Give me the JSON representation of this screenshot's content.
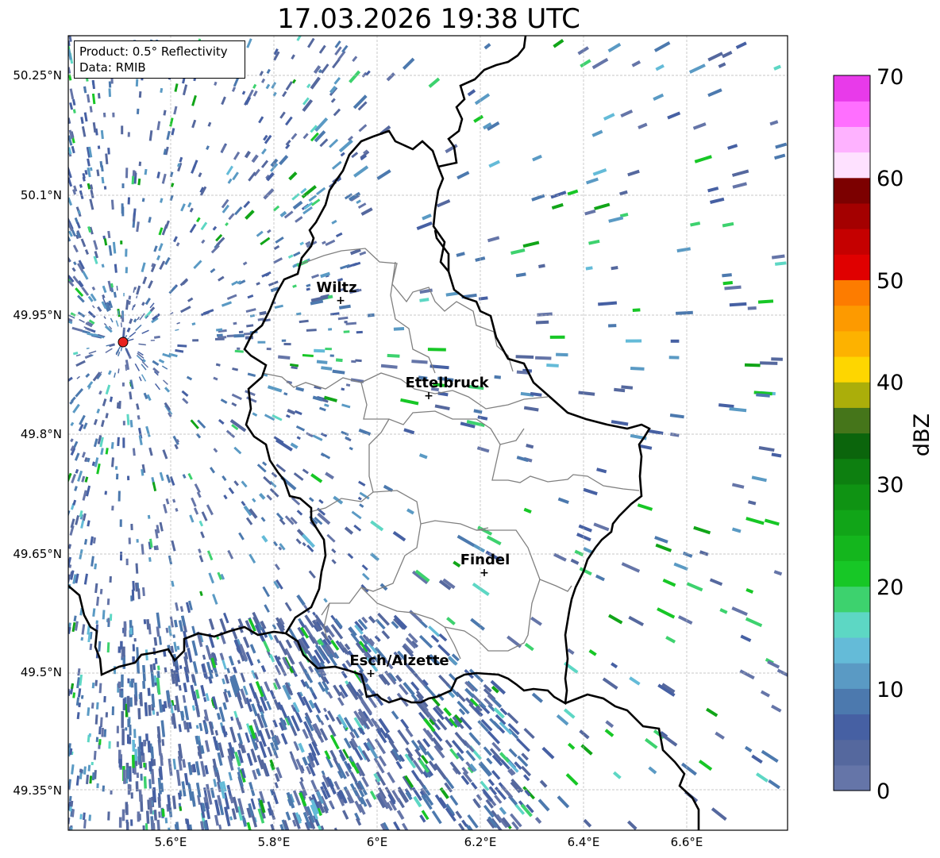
{
  "title": "17.03.2026 19:38 UTC",
  "info": {
    "product": "Product: 0.5° Reflectivity",
    "data_source": "Data: RMIB"
  },
  "lat_ticks": [
    "50.25°N",
    "50.1°N",
    "49.95°N",
    "49.8°N",
    "49.65°N",
    "49.5°N",
    "49.35°N"
  ],
  "lon_ticks": [
    "5.6°E",
    "5.8°E",
    "6°E",
    "6.2°E",
    "6.4°E",
    "6.6°E"
  ],
  "cities": [
    {
      "name": "Wiltz"
    },
    {
      "name": "Ettelbruck"
    },
    {
      "name": "Findel"
    },
    {
      "name": "Esch/Alzette"
    }
  ],
  "colorbar": {
    "label": "dBZ",
    "ticks": [
      "0",
      "10",
      "20",
      "30",
      "40",
      "50",
      "60",
      "70"
    ],
    "colors": [
      "#6575a8",
      "#55689e",
      "#4660a3",
      "#4c79ae",
      "#5a9ac4",
      "#64bbd8",
      "#5dd7c4",
      "#3dd26e",
      "#17c726",
      "#14b61d",
      "#11a518",
      "#0f9313",
      "#0d7f10",
      "#0b650c",
      "#45751a",
      "#abae0a",
      "#fed600",
      "#fdb200",
      "#fd9a00",
      "#fd7c00",
      "#e00000",
      "#c50000",
      "#a40000",
      "#7c0000",
      "#fee1ff",
      "#feb2ff",
      "#ff6fff",
      "#e83aea"
    ]
  },
  "colors": {
    "border": "#000000",
    "district": "#808080",
    "radar_site": "#e8211d",
    "grid": "#b5b5b5"
  }
}
